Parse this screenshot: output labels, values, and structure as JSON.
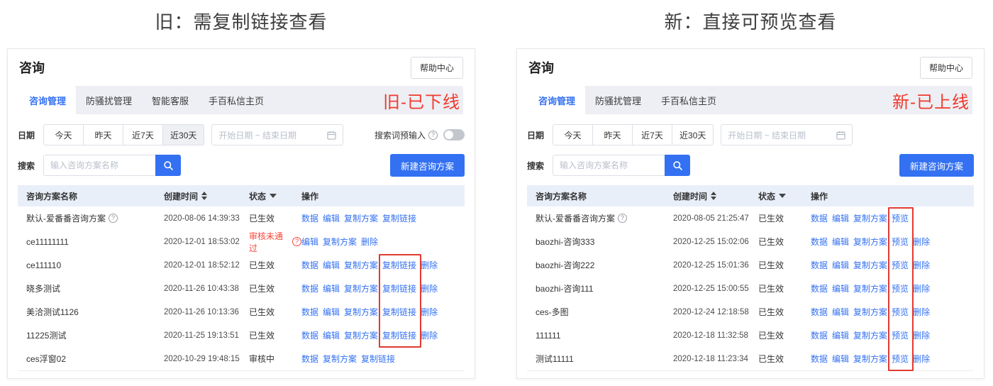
{
  "captions": {
    "old": "旧：需复制链接查看",
    "new": "新：直接可预览查看"
  },
  "colors": {
    "accent_blue": "#3371f2",
    "highlight_box_red": "#e13a31",
    "annotation_red": "#f2392e",
    "status_error_red": "#f5483b",
    "tab_bar_bg": "#edeff4",
    "table_header_bg": "#e9eff9"
  },
  "panels": [
    {
      "version": "old",
      "annotation": "旧-已下线",
      "title": "咨询",
      "help_button": "帮助中心",
      "tabs": [
        {
          "label": "咨询管理",
          "active": true
        },
        {
          "label": "防骚扰管理",
          "active": false
        },
        {
          "label": "智能客服",
          "active": false
        },
        {
          "label": "手百私信主页",
          "active": false
        }
      ],
      "filters": {
        "date_label": "日期",
        "date_presets": [
          "今天",
          "昨天",
          "近7天",
          "近30天"
        ],
        "date_preset_selected": "近30天",
        "date_range_placeholder": "开始日期 ~ 结束日期",
        "preinput": {
          "label": "搜索词预输入",
          "enabled": false
        },
        "search_label": "搜索",
        "search_placeholder": "输入咨询方案名称",
        "create_button": "新建咨询方案"
      },
      "table": {
        "columns": [
          "咨询方案名称",
          "创建时间",
          "状态",
          "操作"
        ],
        "rows": [
          {
            "name": "默认-爱番番咨询方案",
            "name_info_icon": true,
            "time": "2020-08-06 14:39:33",
            "status": "已生效",
            "status_error": false,
            "actions": [
              "数据",
              "编辑",
              "复制方案",
              "复制链接"
            ]
          },
          {
            "name": "ce11111111",
            "name_info_icon": false,
            "time": "2020-12-01 18:53:02",
            "status": "审核未通过",
            "status_error": true,
            "actions": [
              "编辑",
              "复制方案",
              "删除"
            ]
          },
          {
            "name": "ce111110",
            "name_info_icon": false,
            "time": "2020-12-01 18:52:12",
            "status": "已生效",
            "status_error": false,
            "actions": [
              "数据",
              "编辑",
              "复制方案",
              "复制链接",
              "删除"
            ]
          },
          {
            "name": "晓多测试",
            "name_info_icon": false,
            "time": "2020-11-26 10:43:38",
            "status": "已生效",
            "status_error": false,
            "actions": [
              "数据",
              "编辑",
              "复制方案",
              "复制链接",
              "删除"
            ]
          },
          {
            "name": "美洽测试1126",
            "name_info_icon": false,
            "time": "2020-11-26 10:13:36",
            "status": "已生效",
            "status_error": false,
            "actions": [
              "数据",
              "编辑",
              "复制方案",
              "复制链接",
              "删除"
            ]
          },
          {
            "name": "11225测试",
            "name_info_icon": false,
            "time": "2020-11-25 19:13:51",
            "status": "已生效",
            "status_error": false,
            "actions": [
              "数据",
              "编辑",
              "复制方案",
              "复制链接",
              "删除"
            ]
          },
          {
            "name": "ces浮窗02",
            "name_info_icon": false,
            "time": "2020-10-29 19:48:15",
            "status": "审核中",
            "status_error": false,
            "actions": [
              "数据",
              "复制方案",
              "复制链接"
            ]
          }
        ]
      },
      "highlight": {
        "action": "复制链接",
        "row_start": 2,
        "row_end": 5
      }
    },
    {
      "version": "new",
      "annotation": "新-已上线",
      "title": "咨询",
      "help_button": "帮助中心",
      "tabs": [
        {
          "label": "咨询管理",
          "active": true
        },
        {
          "label": "防骚扰管理",
          "active": false
        },
        {
          "label": "手百私信主页",
          "active": false
        }
      ],
      "filters": {
        "date_label": "日期",
        "date_presets": [
          "今天",
          "昨天",
          "近7天",
          "近30天"
        ],
        "date_preset_selected": null,
        "date_range_placeholder": "开始日期 ~ 结束日期",
        "preinput": null,
        "search_label": "搜索",
        "search_placeholder": "输入咨询方案名称",
        "create_button": "新建咨询方案"
      },
      "table": {
        "columns": [
          "咨询方案名称",
          "创建时间",
          "状态",
          "操作"
        ],
        "rows": [
          {
            "name": "默认-爱番番咨询方案",
            "name_info_icon": true,
            "time": "2020-08-05 21:25:47",
            "status": "已生效",
            "status_error": false,
            "actions": [
              "数据",
              "编辑",
              "复制方案",
              "预览"
            ]
          },
          {
            "name": "baozhi-咨询333",
            "name_info_icon": false,
            "time": "2020-12-25 15:02:06",
            "status": "已生效",
            "status_error": false,
            "actions": [
              "数据",
              "编辑",
              "复制方案",
              "预览",
              "删除"
            ]
          },
          {
            "name": "baozhi-咨询222",
            "name_info_icon": false,
            "time": "2020-12-25 15:01:36",
            "status": "已生效",
            "status_error": false,
            "actions": [
              "数据",
              "编辑",
              "复制方案",
              "预览",
              "删除"
            ]
          },
          {
            "name": "baozhi-咨询111",
            "name_info_icon": false,
            "time": "2020-12-25 15:00:55",
            "status": "已生效",
            "status_error": false,
            "actions": [
              "数据",
              "编辑",
              "复制方案",
              "预览",
              "删除"
            ]
          },
          {
            "name": "ces-多图",
            "name_info_icon": false,
            "time": "2020-12-24 12:18:58",
            "status": "已生效",
            "status_error": false,
            "actions": [
              "数据",
              "编辑",
              "复制方案",
              "预览",
              "删除"
            ]
          },
          {
            "name": "111111",
            "name_info_icon": false,
            "time": "2020-12-18 11:32:58",
            "status": "已生效",
            "status_error": false,
            "actions": [
              "数据",
              "编辑",
              "复制方案",
              "预览",
              "删除"
            ]
          },
          {
            "name": "测试11111",
            "name_info_icon": false,
            "time": "2020-12-18 11:23:34",
            "status": "已生效",
            "status_error": false,
            "actions": [
              "数据",
              "编辑",
              "复制方案",
              "预览",
              "删除"
            ]
          }
        ]
      },
      "highlight": {
        "action": "预览",
        "row_start": 0,
        "row_end": 6
      }
    }
  ]
}
